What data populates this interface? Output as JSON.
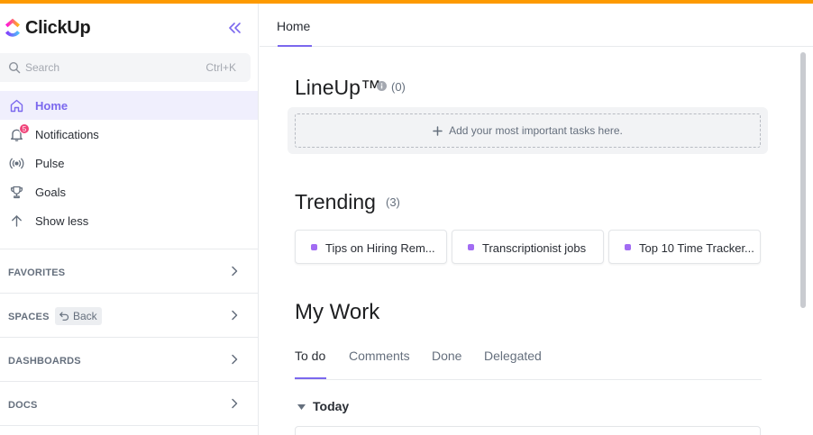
{
  "app": {
    "name": "ClickUp",
    "accent_color": "#7b68ee",
    "top_bar_color": "#fd9a00"
  },
  "sidebar": {
    "search": {
      "placeholder": "Search",
      "shortcut": "Ctrl+K",
      "icon": "search-icon"
    },
    "nav": [
      {
        "label": "Home",
        "icon": "home-icon",
        "active": true
      },
      {
        "label": "Notifications",
        "icon": "bell-icon",
        "badge": "5"
      },
      {
        "label": "Pulse",
        "icon": "pulse-icon"
      },
      {
        "label": "Goals",
        "icon": "trophy-icon"
      },
      {
        "label": "Show less",
        "icon": "arrow-up-icon"
      }
    ],
    "sections": [
      {
        "label": "FAVORITES"
      },
      {
        "label": "SPACES",
        "back_label": "Back"
      },
      {
        "label": "DASHBOARDS"
      },
      {
        "label": "DOCS"
      }
    ]
  },
  "header": {
    "tab": "Home"
  },
  "lineup": {
    "title": "LineUp™",
    "count": "(0)",
    "placeholder": "Add your most important tasks here."
  },
  "trending": {
    "title": "Trending",
    "count": "(3)",
    "items": [
      {
        "label": "Tips on Hiring Rem..."
      },
      {
        "label": "Transcriptionist jobs"
      },
      {
        "label": "Top 10 Time Tracker..."
      }
    ],
    "dot_color": "#a26cf3"
  },
  "my_work": {
    "title": "My Work",
    "tabs": [
      "To do",
      "Comments",
      "Done",
      "Delegated"
    ],
    "active_tab": "To do",
    "group": "Today"
  }
}
